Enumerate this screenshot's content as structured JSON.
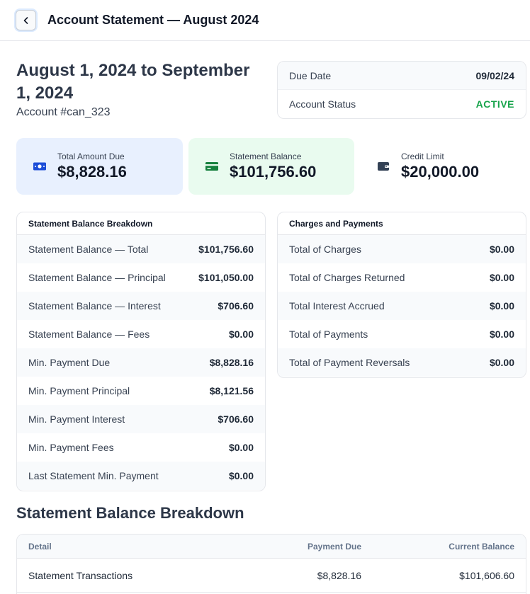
{
  "header": {
    "title": "Account Statement — August 2024"
  },
  "period": {
    "title": "August 1, 2024 to September 1, 2024",
    "account": "Account #can_323"
  },
  "due": {
    "due_date_label": "Due Date",
    "due_date_value": "09/02/24",
    "status_label": "Account Status",
    "status_value": "ACTIVE"
  },
  "colors": {
    "status_active": "#16a34a",
    "accent_blue": "#1d4ed8",
    "accent_green": "#15803d"
  },
  "cards": [
    {
      "label": "Total Amount Due",
      "value": "$8,828.16",
      "icon": "money-bill-icon"
    },
    {
      "label": "Statement Balance",
      "value": "$101,756.60",
      "icon": "credit-card-icon"
    },
    {
      "label": "Credit Limit",
      "value": "$20,000.00",
      "icon": "wallet-icon"
    }
  ],
  "breakdown": {
    "heading": "Statement Balance Breakdown",
    "rows": [
      {
        "label": "Statement Balance — Total",
        "value": "$101,756.60"
      },
      {
        "label": "Statement Balance — Principal",
        "value": "$101,050.00"
      },
      {
        "label": "Statement Balance — Interest",
        "value": "$706.60"
      },
      {
        "label": "Statement Balance — Fees",
        "value": "$0.00"
      },
      {
        "label": "Min. Payment Due",
        "value": "$8,828.16"
      },
      {
        "label": "Min. Payment Principal",
        "value": "$8,121.56"
      },
      {
        "label": "Min. Payment Interest",
        "value": "$706.60"
      },
      {
        "label": "Min. Payment Fees",
        "value": "$0.00"
      },
      {
        "label": "Last Statement Min. Payment",
        "value": "$0.00"
      }
    ]
  },
  "charges": {
    "heading": "Charges and Payments",
    "rows": [
      {
        "label": "Total of Charges",
        "value": "$0.00"
      },
      {
        "label": "Total of Charges Returned",
        "value": "$0.00"
      },
      {
        "label": "Total Interest Accrued",
        "value": "$0.00"
      },
      {
        "label": "Total of Payments",
        "value": "$0.00"
      },
      {
        "label": "Total of Payment Reversals",
        "value": "$0.00"
      }
    ]
  },
  "section": {
    "title": "Statement Balance Breakdown"
  },
  "detail_table": {
    "columns": [
      "Detail",
      "Payment Due",
      "Current Balance"
    ],
    "rows": [
      {
        "detail": "Statement Transactions",
        "payment_due": "$8,828.16",
        "current_balance": "$101,606.60"
      }
    ]
  }
}
